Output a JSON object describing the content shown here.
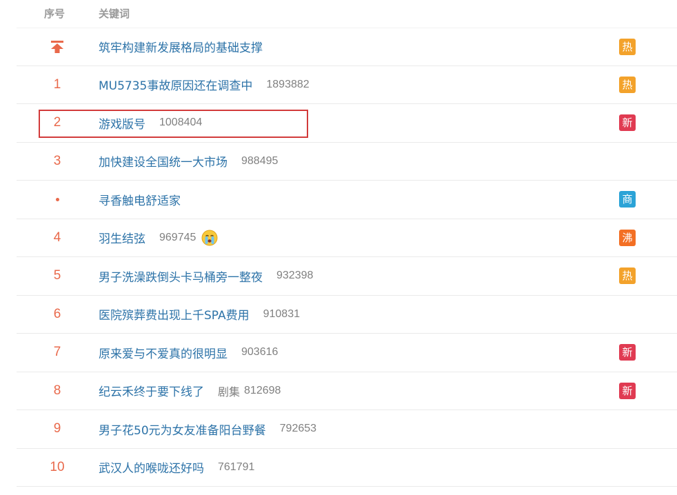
{
  "header": {
    "rank_label": "序号",
    "keyword_label": "关键词"
  },
  "badge_colors": {
    "热": "#f3a22b",
    "新": "#e03b52",
    "商": "#2ba3d7",
    "沸": "#f36f24"
  },
  "accent": {
    "rank": "#e9694b",
    "keyword": "#2d73a8",
    "number": "#808080"
  },
  "rows": [
    {
      "rank": "",
      "rank_type": "pinned",
      "rank_icon": "pin-top-icon",
      "keyword": "筑牢构建新发展格局的基础支撑",
      "number": "",
      "badge": "热"
    },
    {
      "rank": "1",
      "keyword": "MU5735事故原因还在调查中",
      "number": "1893882",
      "badge": "热"
    },
    {
      "rank": "2",
      "keyword": "游戏版号",
      "number": "1008404",
      "badge": "新",
      "highlighted": true
    },
    {
      "rank": "3",
      "keyword": "加快建设全国统一大市场",
      "number": "988495",
      "badge": ""
    },
    {
      "rank": "",
      "rank_type": "dot",
      "keyword": "寻香触电舒适家",
      "number": "",
      "badge": "商"
    },
    {
      "rank": "4",
      "keyword": "羽生结弦",
      "number": "969745",
      "emoji": "crying-face-icon",
      "badge": "沸"
    },
    {
      "rank": "5",
      "keyword": "男子洗澡跌倒头卡马桶旁一整夜",
      "number": "932398",
      "badge": "热"
    },
    {
      "rank": "6",
      "keyword": "医院殡葬费出现上千SPA费用",
      "number": "910831",
      "badge": ""
    },
    {
      "rank": "7",
      "keyword": "原来爱与不爱真的很明显",
      "number": "903616",
      "badge": "新"
    },
    {
      "rank": "8",
      "keyword": "纪云禾终于要下线了",
      "category": "剧集",
      "number": "812698",
      "badge": "新"
    },
    {
      "rank": "9",
      "keyword": "男子花50元为女友准备阳台野餐",
      "number": "792653",
      "badge": ""
    },
    {
      "rank": "10",
      "keyword": "武汉人的喉咙还好吗",
      "number": "761791",
      "badge": ""
    }
  ]
}
